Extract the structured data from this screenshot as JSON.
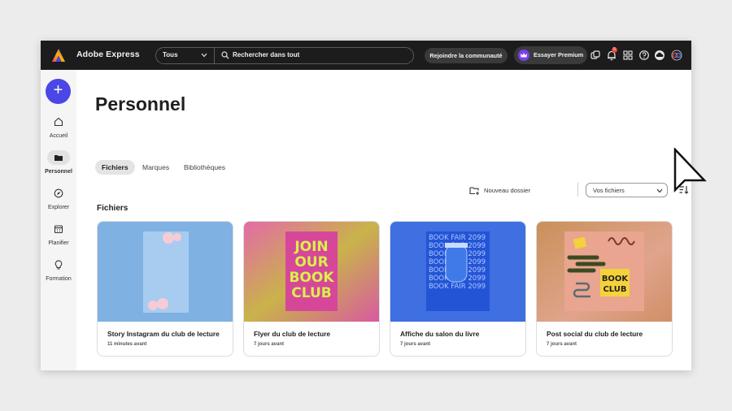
{
  "app": {
    "brand_name": "Adobe Express"
  },
  "topbar": {
    "scope_selected": "Tous",
    "search_placeholder": "Rechercher dans tout",
    "community_label": "Rejoindre la communauté",
    "premium_label": "Essayer Premium",
    "notification_count": "5",
    "icons": [
      "share-icon",
      "bell-icon",
      "apps-grid-icon",
      "help-icon",
      "creative-cloud-icon",
      "avatar-icon"
    ]
  },
  "rail": {
    "add_label": "+",
    "items": [
      {
        "label": "Accueil",
        "icon": "home-icon"
      },
      {
        "label": "Personnel",
        "icon": "folder-icon",
        "active": true
      },
      {
        "label": "Explorer",
        "icon": "compass-icon"
      },
      {
        "label": "Planifier",
        "icon": "calendar-icon"
      },
      {
        "label": "Formation",
        "icon": "lightbulb-icon"
      }
    ]
  },
  "main": {
    "title": "Personnel",
    "tabs": [
      {
        "label": "Fichiers",
        "active": true
      },
      {
        "label": "Marques"
      },
      {
        "label": "Bibliothèques"
      }
    ],
    "toolbar": {
      "new_folder_label": "Nouveau dossier",
      "filter_selected": "Vos fichiers"
    },
    "section_title": "Fichiers",
    "files": [
      {
        "title": "Story Instagram du club de lecture",
        "meta": "11 minutes avant"
      },
      {
        "title": "Flyer du club de lecture",
        "meta": "7 jours avant"
      },
      {
        "title": "Affiche du salon du livre",
        "meta": "7 jours avant"
      },
      {
        "title": "Post social du club de lecture",
        "meta": "7 jours avant"
      }
    ],
    "flyer_text": [
      "JOIN",
      "OUR",
      "BOOK",
      "CLUB"
    ],
    "poster_line": "BOOK FAIR 2099",
    "social_text": [
      "BOOK",
      "CLUB"
    ]
  },
  "colors": {
    "topbar_bg": "#1c1c1c",
    "accent": "#4b46e6",
    "premium": "#7b3df0",
    "badge": "#e8403c"
  }
}
